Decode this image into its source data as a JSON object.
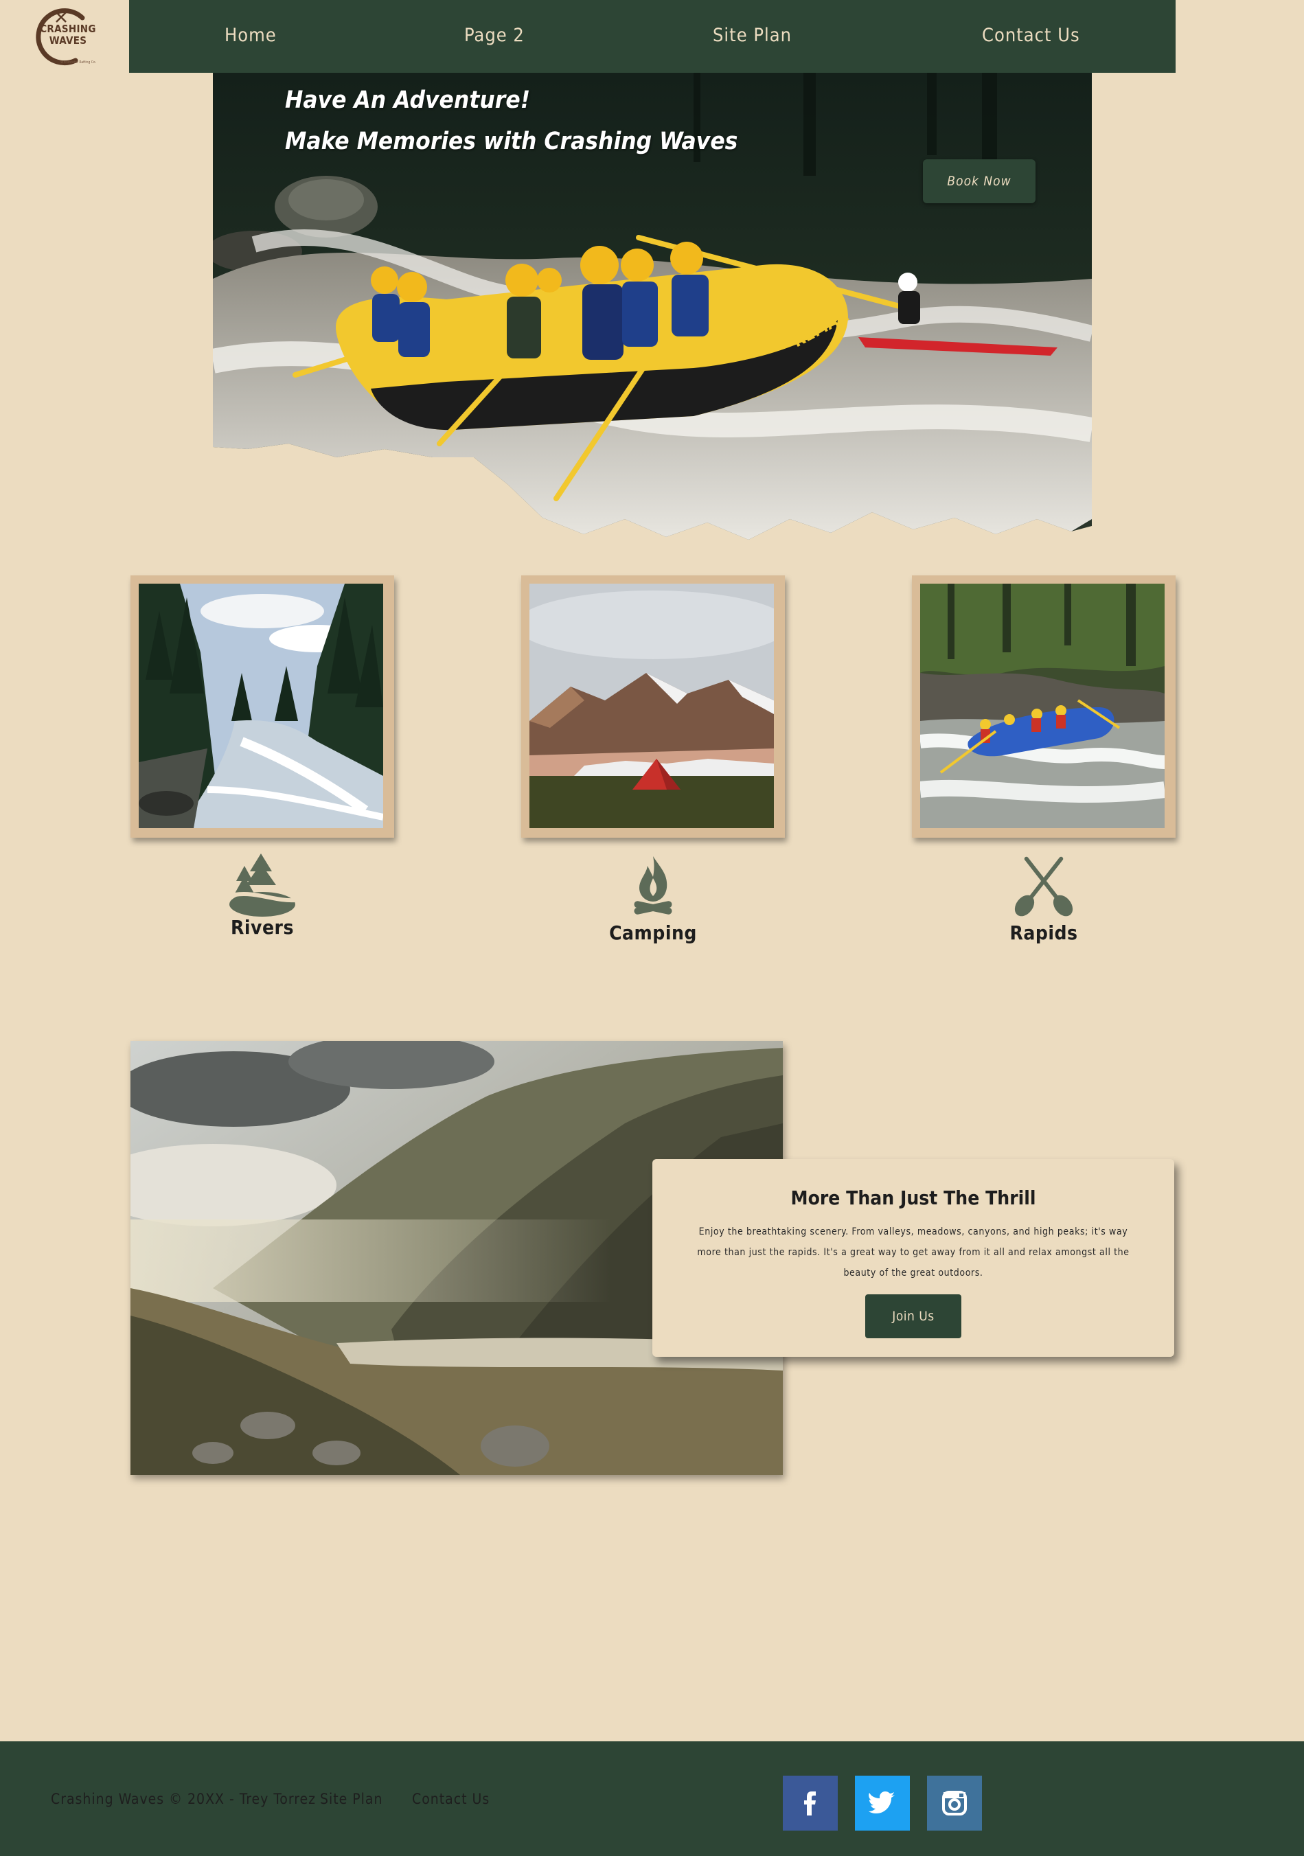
{
  "header": {
    "logo_text_line1": "CRASHING",
    "logo_text_line2": "WAVES",
    "logo_tagline": "Whitewater Rafting Co.",
    "nav": [
      "Home",
      "Page 2",
      "Site Plan",
      "Contact Us"
    ]
  },
  "hero": {
    "line1": "Have An Adventure!",
    "line2": "Make Memories with Crashing Waves",
    "book_button": "Book Now",
    "raft_text": "REMAR"
  },
  "features": [
    {
      "label": "Rivers",
      "icon": "river-trees-icon"
    },
    {
      "label": "Camping",
      "icon": "campfire-icon"
    },
    {
      "label": "Rapids",
      "icon": "crossed-paddles-icon"
    }
  ],
  "about": {
    "title": "More Than Just The Thrill",
    "body": "Enjoy the breathtaking scenery. From valleys, meadows, canyons, and high peaks; it's way more than just the rapids. It's a great way to get away from it all and relax amongst all the beauty of the great outdoors.",
    "button": "Join Us"
  },
  "footer": {
    "copyright": "Crashing Waves © 20XX - Trey Torrez",
    "site_plan": "Site Plan",
    "contact": "Contact Us",
    "social": [
      {
        "name": "facebook-icon",
        "color": "#3b5998"
      },
      {
        "name": "twitter-icon",
        "color": "#1da1f2"
      },
      {
        "name": "instagram-icon",
        "color": "#3f729b"
      }
    ]
  },
  "colors": {
    "background": "#ecdcc0",
    "primary": "#2d4535",
    "frame": "#d9bc98",
    "icon": "#5d6b58"
  }
}
